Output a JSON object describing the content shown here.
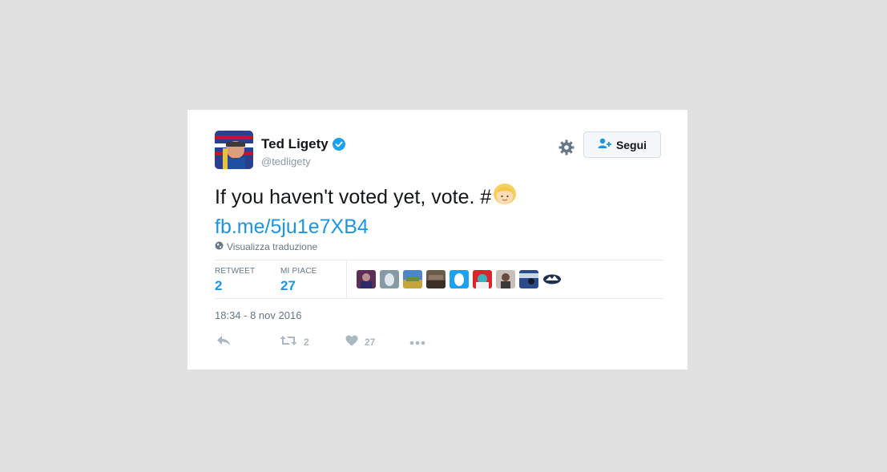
{
  "user": {
    "name": "Ted Ligety",
    "handle": "@tedligety"
  },
  "follow_label": "Segui",
  "tweet": {
    "text": "If you haven't voted yet, vote. #",
    "link": "fb.me/5ju1e7XB4"
  },
  "translate_label": "Visualizza traduzione",
  "stats": {
    "retweet_label": "RETWEET",
    "retweet_count": "2",
    "likes_label": "MI PIACE",
    "likes_count": "27"
  },
  "timestamp": "18:34 - 8 nov 2016",
  "actions": {
    "retweet_count": "2",
    "like_count": "27"
  },
  "colors": {
    "link": "#1b95e0",
    "verified": "#1da1f2",
    "background": "#e1e1e1"
  }
}
